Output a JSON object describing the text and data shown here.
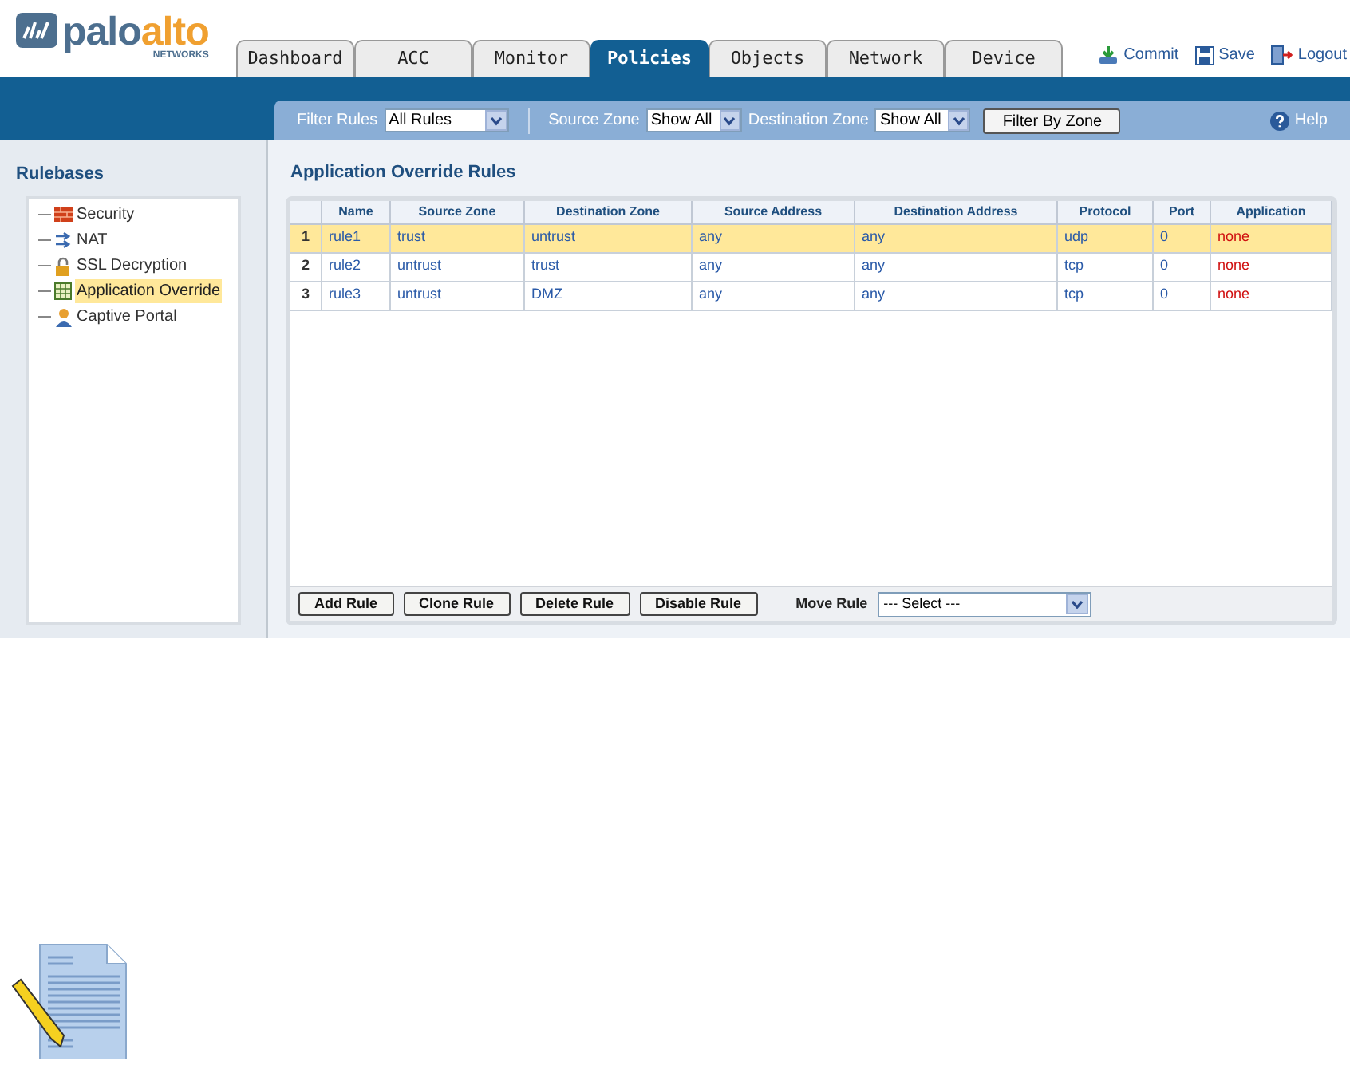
{
  "logo": {
    "text_dark": "palo",
    "text_accent": "alto",
    "subtitle": "NETWORKS"
  },
  "tabs": [
    {
      "label": "Dashboard",
      "selected": false
    },
    {
      "label": "ACC",
      "selected": false
    },
    {
      "label": "Monitor",
      "selected": false
    },
    {
      "label": "Policies",
      "selected": true
    },
    {
      "label": "Objects",
      "selected": false
    },
    {
      "label": "Network",
      "selected": false
    },
    {
      "label": "Device",
      "selected": false
    }
  ],
  "header_links": [
    {
      "kind": "commit",
      "label": "Commit"
    },
    {
      "kind": "save",
      "label": "Save"
    },
    {
      "kind": "logout",
      "label": "Logout"
    }
  ],
  "filter_bar": {
    "filter_rules_label": "Filter Rules",
    "filter_rules_value": "All Rules",
    "source_zone_label": "Source Zone",
    "source_zone_value": "Show All",
    "destination_zone_label": "Destination Zone",
    "destination_zone_value": "Show All",
    "filter_button": "Filter By Zone",
    "help": "Help"
  },
  "sidebar": {
    "title": "Rulebases",
    "items": [
      {
        "kind": "security",
        "label": "Security",
        "selected": false
      },
      {
        "kind": "nat",
        "label": "NAT",
        "selected": false
      },
      {
        "kind": "ssl",
        "label": "SSL Decryption",
        "selected": false
      },
      {
        "kind": "override",
        "label": "Application Override",
        "selected": true
      },
      {
        "kind": "portal",
        "label": "Captive Portal",
        "selected": false
      }
    ]
  },
  "table": {
    "title": "Application Override Rules",
    "columns": [
      "Name",
      "Source Zone",
      "Destination Zone",
      "Source Address",
      "Destination Address",
      "Protocol",
      "Port",
      "Application"
    ],
    "rows": [
      {
        "index": "1",
        "cells": [
          "rule1",
          "trust",
          "untrust",
          "any",
          "any",
          "udp",
          "0",
          "none"
        ],
        "selected": true
      },
      {
        "index": "2",
        "cells": [
          "rule2",
          "untrust",
          "trust",
          "any",
          "any",
          "tcp",
          "0",
          "none"
        ],
        "selected": false
      },
      {
        "index": "3",
        "cells": [
          "rule3",
          "untrust",
          "DMZ",
          "any",
          "any",
          "tcp",
          "0",
          "none"
        ],
        "selected": false
      }
    ]
  },
  "actions": {
    "buttons": [
      "Add Rule",
      "Clone Rule",
      "Delete Rule",
      "Disable Rule"
    ],
    "move_rule_label": "Move Rule",
    "move_rule_value": "--- Select ---"
  }
}
